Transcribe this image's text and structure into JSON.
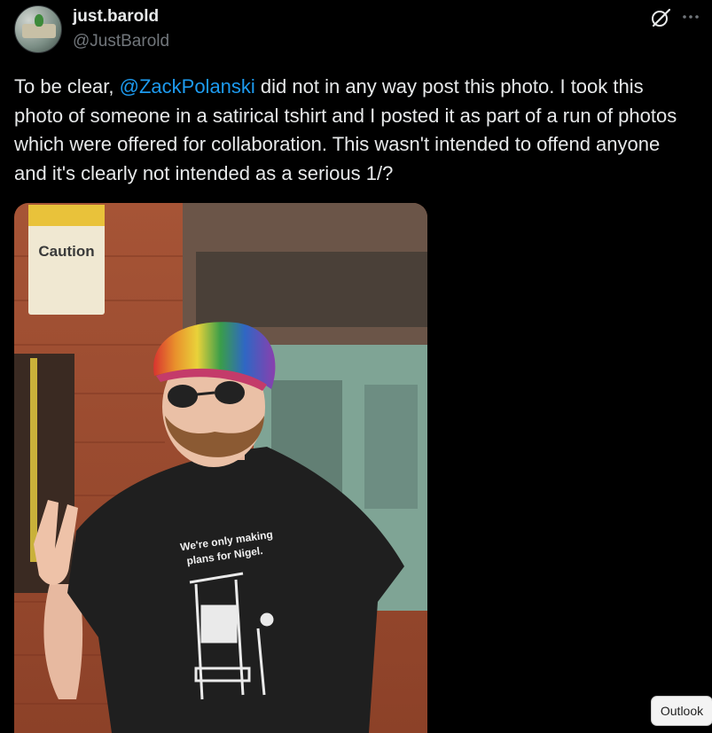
{
  "author": {
    "display_name": "just.barold",
    "handle": "@JustBarold"
  },
  "header_icons": {
    "grok": "grok-icon",
    "more": "more-icon"
  },
  "post": {
    "text_before_mention": "To be clear, ",
    "mention": "@ZackPolanski",
    "text_after_mention": " did not in any way post this photo. I took this photo of someone in a satirical tshirt and I posted it as part of a run of photos which were offered for collaboration. This wasn't intended to offend anyone and it's clearly not intended as a serious 1/?"
  },
  "photo": {
    "sign_text": "Caution",
    "shirt_line_1": "We're only making",
    "shirt_line_2": "plans for Nigel."
  },
  "overlay": {
    "outlook_label": "Outlook"
  },
  "colors": {
    "background": "#000000",
    "text_primary": "#e7e9ea",
    "text_secondary": "#71767b",
    "link": "#1d9bf0"
  }
}
